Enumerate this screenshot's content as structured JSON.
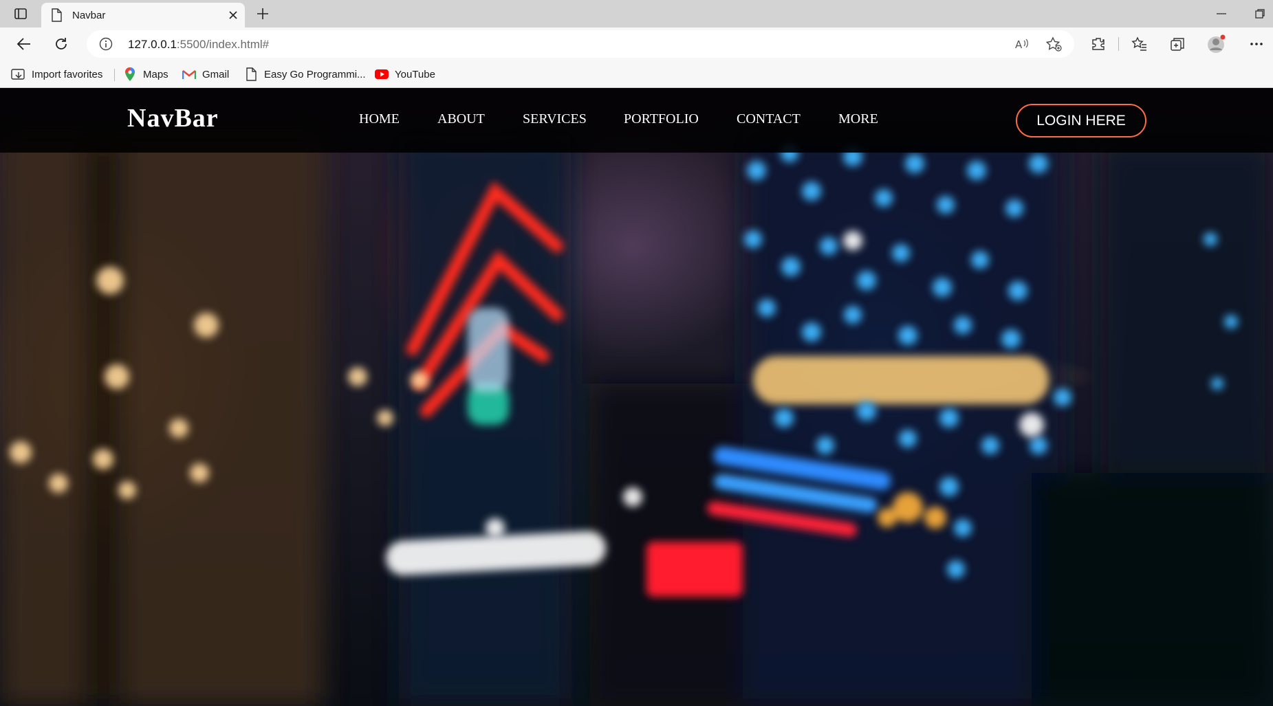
{
  "browser": {
    "tab": {
      "title": "Navbar"
    },
    "address_bar": {
      "url_host": "127.0.0.1",
      "url_rest": ":5500/index.html#"
    },
    "bookmarks": [
      {
        "label": "Import favorites",
        "icon": "import-icon"
      },
      {
        "label": "Maps",
        "icon": "maps-pin-icon"
      },
      {
        "label": "Gmail",
        "icon": "gmail-icon"
      },
      {
        "label": "Easy Go Programmi...",
        "icon": "page-icon"
      },
      {
        "label": "YouTube",
        "icon": "youtube-icon"
      }
    ]
  },
  "site": {
    "logo": "NavBar",
    "nav": [
      "HOME",
      "ABOUT",
      "SERVICES",
      "PORTFOLIO",
      "CONTACT",
      "MORE"
    ],
    "login_button": "LOGIN HERE"
  },
  "colors": {
    "navbar_bg": "#000000",
    "login_border": "#ff6b4a",
    "text": "#ffffff"
  }
}
